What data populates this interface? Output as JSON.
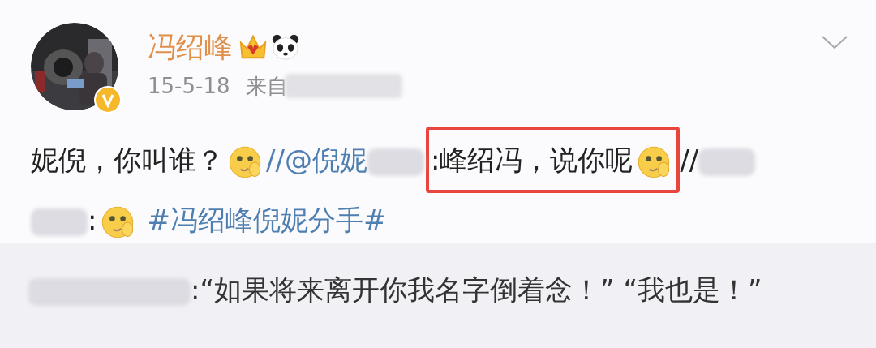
{
  "post": {
    "author": {
      "name": "冯绍峰",
      "verified": true,
      "badges": [
        {
          "kind": "crown"
        },
        {
          "kind": "panda"
        }
      ]
    },
    "time": "15-5-18",
    "source": "来自",
    "body": [
      {
        "kind": "text",
        "text": "妮倪，你叫谁？"
      },
      {
        "kind": "emoji"
      },
      {
        "kind": "mention",
        "text": "//@倪妮"
      },
      {
        "kind": "blur"
      },
      {
        "kind": "highlight",
        "parts": [
          {
            "kind": "text",
            "text": ":峰绍冯，说你呢"
          },
          {
            "kind": "emoji"
          }
        ]
      },
      {
        "kind": "text",
        "text": "//"
      },
      {
        "kind": "blur"
      },
      {
        "kind": "break"
      },
      {
        "kind": "blur"
      },
      {
        "kind": "text",
        "text": ":"
      },
      {
        "kind": "emoji"
      },
      {
        "kind": "hashtag",
        "text": "#冯绍峰倪妮分手#"
      }
    ]
  },
  "comment": {
    "text": ":“如果将来离开你我名字倒着念！” “我也是！”"
  }
}
